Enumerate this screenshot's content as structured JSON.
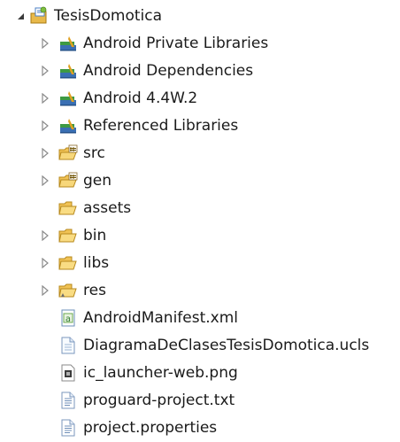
{
  "project": {
    "label": "TesisDomotica",
    "icon": "android-project-icon",
    "expanded": true
  },
  "items": [
    {
      "label": "Android Private Libraries",
      "icon": "library-container-icon",
      "expandable": true
    },
    {
      "label": "Android Dependencies",
      "icon": "library-container-icon",
      "expandable": true
    },
    {
      "label": "Android 4.4W.2",
      "icon": "library-container-icon",
      "expandable": true
    },
    {
      "label": "Referenced Libraries",
      "icon": "library-container-icon",
      "expandable": true
    },
    {
      "label": "src",
      "icon": "source-folder-icon",
      "expandable": true
    },
    {
      "label": "gen",
      "icon": "source-folder-icon",
      "expandable": true
    },
    {
      "label": "assets",
      "icon": "folder-icon",
      "expandable": false
    },
    {
      "label": "bin",
      "icon": "folder-icon",
      "expandable": true
    },
    {
      "label": "libs",
      "icon": "folder-icon",
      "expandable": true
    },
    {
      "label": "res",
      "icon": "resource-folder-icon",
      "expandable": true
    },
    {
      "label": "AndroidManifest.xml",
      "icon": "android-manifest-icon",
      "expandable": false
    },
    {
      "label": "DiagramaDeClasesTesisDomotica.ucls",
      "icon": "file-icon",
      "expandable": false
    },
    {
      "label": "ic_launcher-web.png",
      "icon": "image-file-icon",
      "expandable": false
    },
    {
      "label": "proguard-project.txt",
      "icon": "text-file-icon",
      "expandable": false
    },
    {
      "label": "project.properties",
      "icon": "text-file-icon",
      "expandable": false
    }
  ],
  "colors": {
    "folder": "#f1c75a",
    "library_books": "#2f6bb0",
    "library_green": "#3d9a3d",
    "twisty": "#8a8a8a"
  }
}
